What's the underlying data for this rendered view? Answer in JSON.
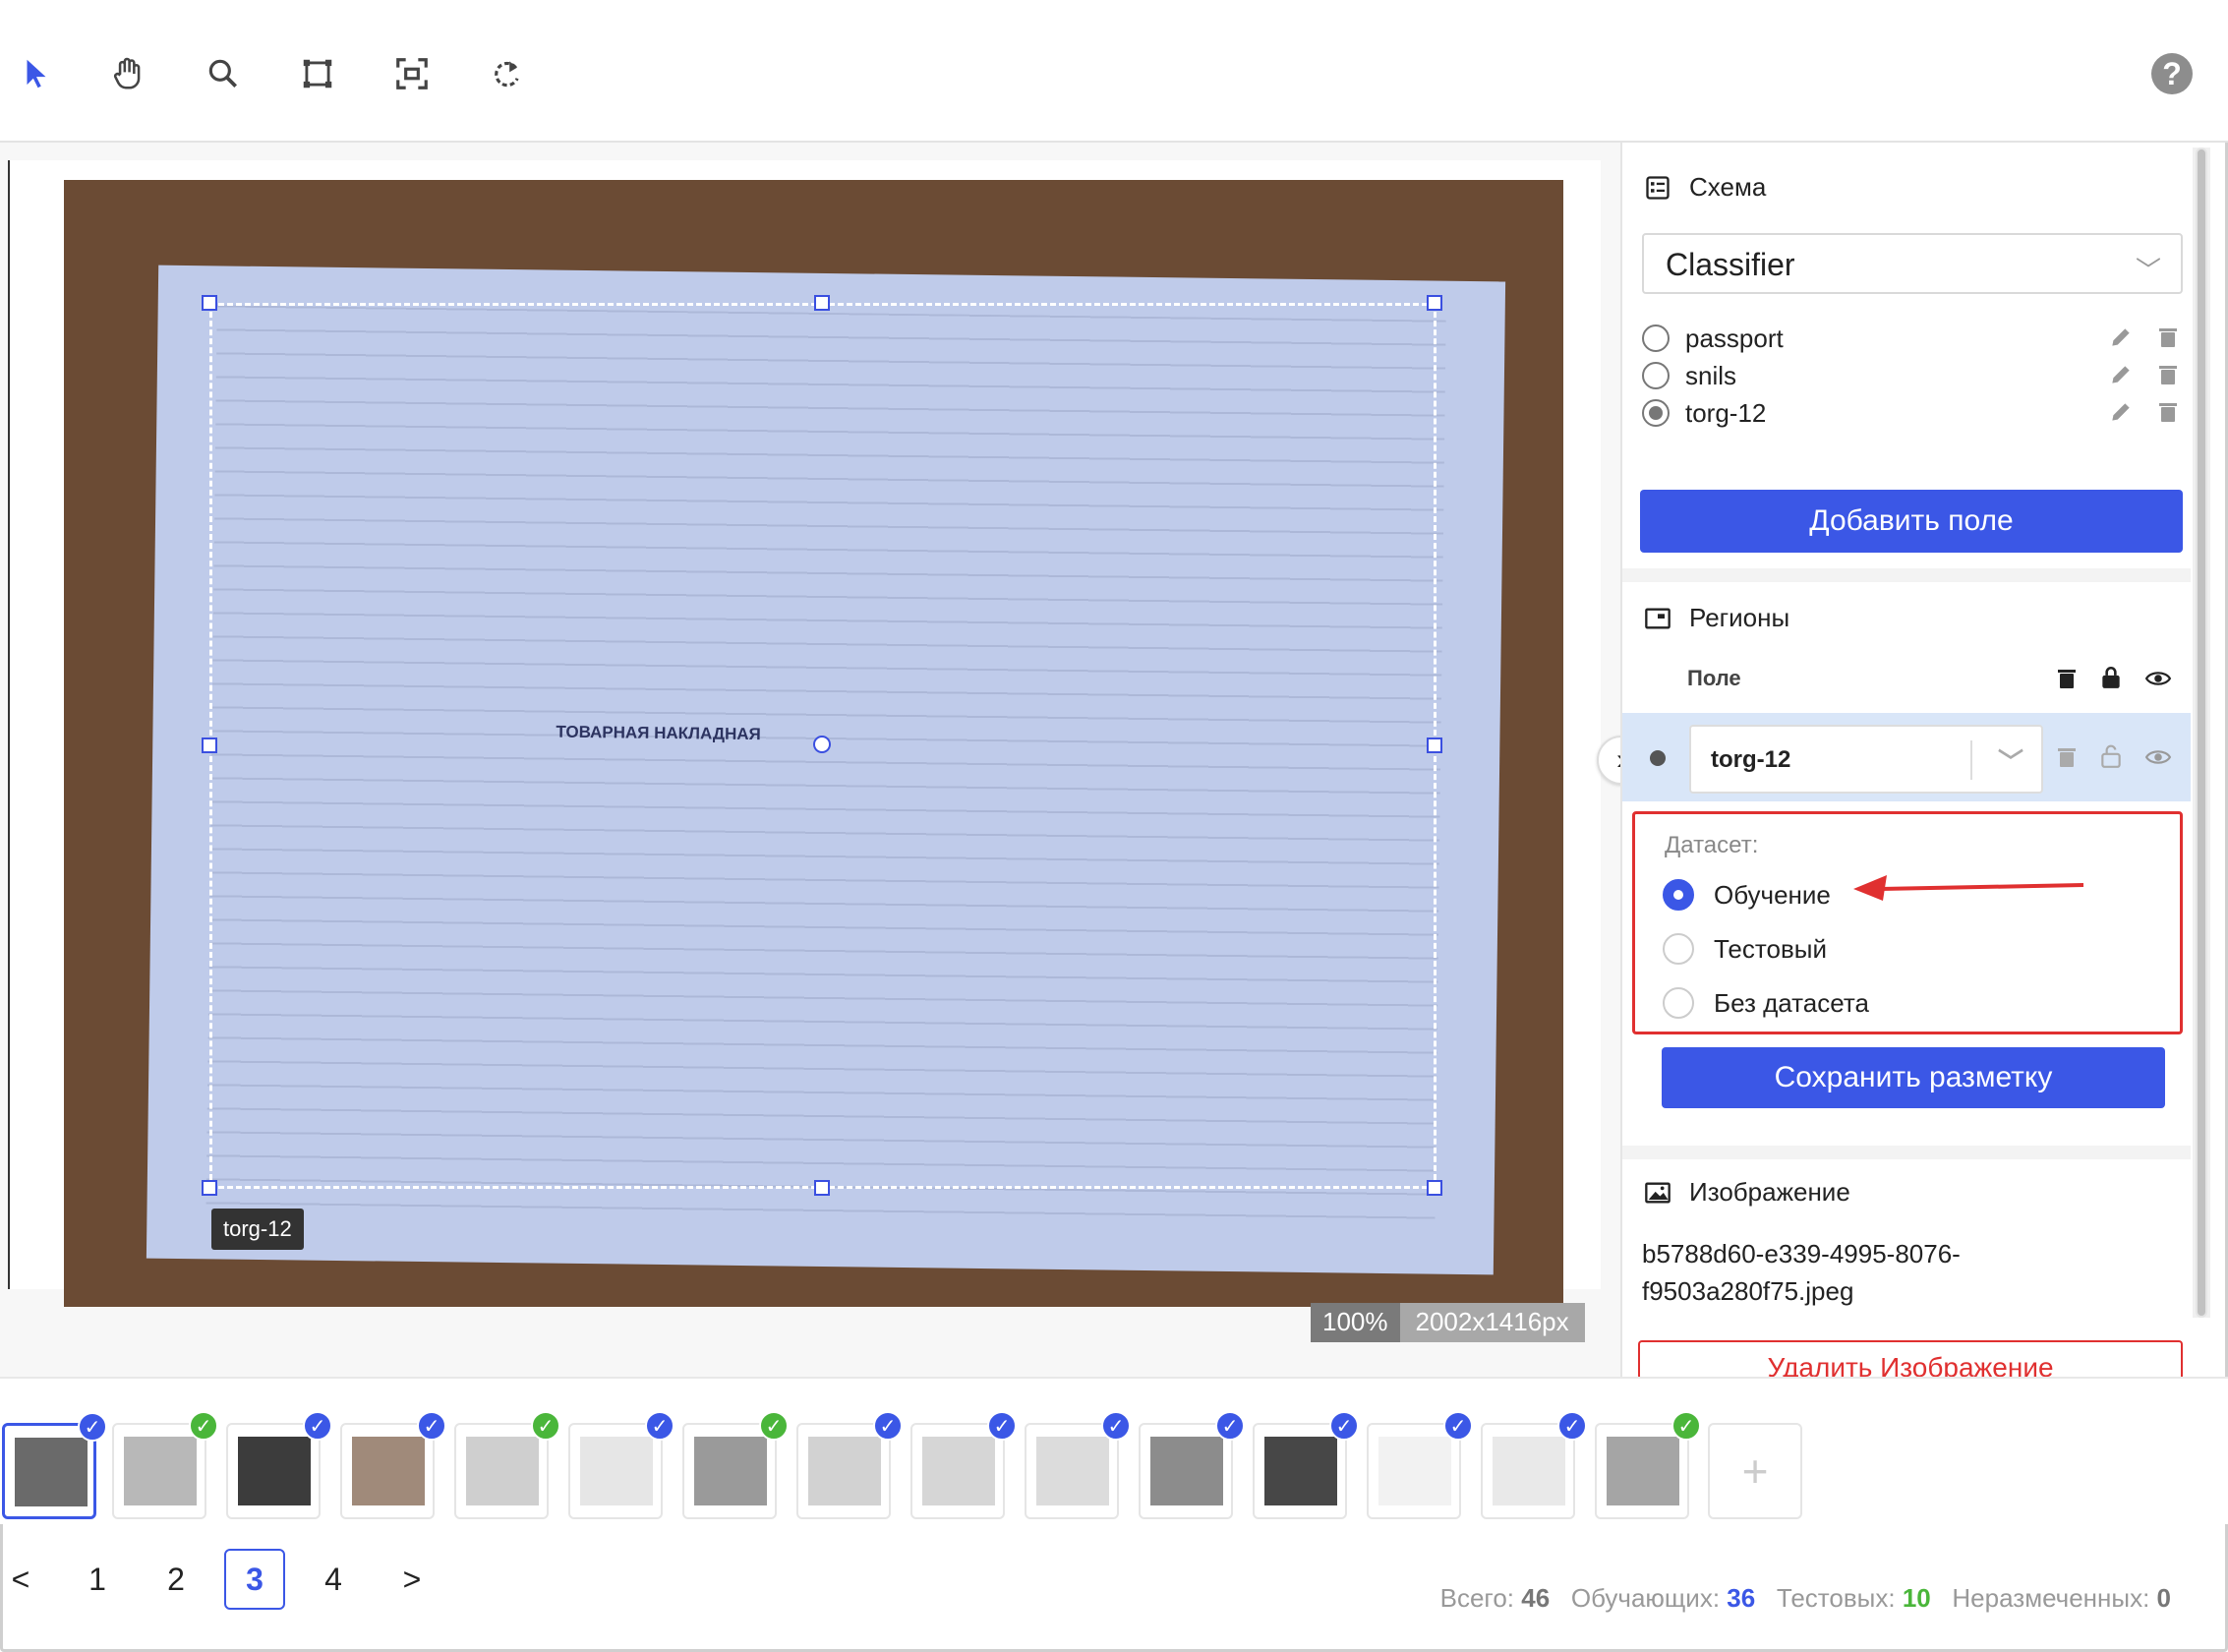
{
  "toolbar": {
    "tools": [
      "select-icon",
      "pan-icon",
      "zoom-icon",
      "bbox-icon",
      "fit-icon",
      "rotate-icon"
    ],
    "help": "?"
  },
  "canvas": {
    "document_title": "ТОВАРНАЯ НАКЛАДНАЯ",
    "region_label": "torg-12",
    "zoom": "100%",
    "image_size": "2002x1416px"
  },
  "panel": {
    "schema": {
      "title": "Схема",
      "select_value": "Classifier",
      "fields": [
        {
          "label": "passport",
          "checked": false
        },
        {
          "label": "snils",
          "checked": false
        },
        {
          "label": "torg-12",
          "checked": true
        }
      ],
      "add_field": "Добавить поле"
    },
    "regions": {
      "title": "Регионы",
      "column_field": "Поле",
      "row_value": "torg-12"
    },
    "dataset": {
      "label": "Датасет:",
      "options": [
        {
          "label": "Обучение",
          "checked": true
        },
        {
          "label": "Тестовый",
          "checked": false
        },
        {
          "label": "Без датасета",
          "checked": false
        }
      ],
      "save": "Сохранить разметку"
    },
    "image": {
      "title": "Изображение",
      "name_line1": "b5788d60-e339-4995-8076-",
      "name_line2": "f9503a280f75.jpeg",
      "delete": "Удалить Изображение"
    }
  },
  "thumbnails": [
    {
      "status": "blue",
      "selected": true
    },
    {
      "status": "green"
    },
    {
      "status": "blue"
    },
    {
      "status": "blue"
    },
    {
      "status": "green"
    },
    {
      "status": "blue"
    },
    {
      "status": "green"
    },
    {
      "status": "blue"
    },
    {
      "status": "blue"
    },
    {
      "status": "blue"
    },
    {
      "status": "blue"
    },
    {
      "status": "blue"
    },
    {
      "status": "blue"
    },
    {
      "status": "blue"
    },
    {
      "status": "green"
    }
  ],
  "pagination": {
    "prev": "<",
    "pages": [
      "1",
      "2",
      "3",
      "4"
    ],
    "current": "3",
    "next": ">"
  },
  "stats": {
    "total_label": "Всего:",
    "total": "46",
    "train_label": "Обучающих:",
    "train": "36",
    "test_label": "Тестовых:",
    "test": "10",
    "unlabeled_label": "Неразмеченных:",
    "unlabeled": "0",
    "colors": {
      "train": "#3b57e6",
      "test": "#4ab63a",
      "default": "#777777"
    }
  }
}
